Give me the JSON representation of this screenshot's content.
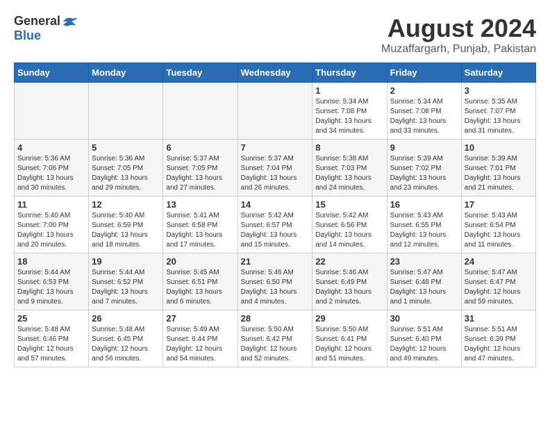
{
  "logo": {
    "general": "General",
    "blue": "Blue"
  },
  "title": "August 2024",
  "location": "Muzaffargarh, Punjab, Pakistan",
  "days_header": [
    "Sunday",
    "Monday",
    "Tuesday",
    "Wednesday",
    "Thursday",
    "Friday",
    "Saturday"
  ],
  "weeks": [
    [
      {
        "day": "",
        "info": ""
      },
      {
        "day": "",
        "info": ""
      },
      {
        "day": "",
        "info": ""
      },
      {
        "day": "",
        "info": ""
      },
      {
        "day": "1",
        "info": "Sunrise: 5:34 AM\nSunset: 7:08 PM\nDaylight: 13 hours\nand 34 minutes."
      },
      {
        "day": "2",
        "info": "Sunrise: 5:34 AM\nSunset: 7:08 PM\nDaylight: 13 hours\nand 33 minutes."
      },
      {
        "day": "3",
        "info": "Sunrise: 5:35 AM\nSunset: 7:07 PM\nDaylight: 13 hours\nand 31 minutes."
      }
    ],
    [
      {
        "day": "4",
        "info": "Sunrise: 5:36 AM\nSunset: 7:06 PM\nDaylight: 13 hours\nand 30 minutes."
      },
      {
        "day": "5",
        "info": "Sunrise: 5:36 AM\nSunset: 7:05 PM\nDaylight: 13 hours\nand 29 minutes."
      },
      {
        "day": "6",
        "info": "Sunrise: 5:37 AM\nSunset: 7:05 PM\nDaylight: 13 hours\nand 27 minutes."
      },
      {
        "day": "7",
        "info": "Sunrise: 5:37 AM\nSunset: 7:04 PM\nDaylight: 13 hours\nand 26 minutes."
      },
      {
        "day": "8",
        "info": "Sunrise: 5:38 AM\nSunset: 7:03 PM\nDaylight: 13 hours\nand 24 minutes."
      },
      {
        "day": "9",
        "info": "Sunrise: 5:39 AM\nSunset: 7:02 PM\nDaylight: 13 hours\nand 23 minutes."
      },
      {
        "day": "10",
        "info": "Sunrise: 5:39 AM\nSunset: 7:01 PM\nDaylight: 13 hours\nand 21 minutes."
      }
    ],
    [
      {
        "day": "11",
        "info": "Sunrise: 5:40 AM\nSunset: 7:00 PM\nDaylight: 13 hours\nand 20 minutes."
      },
      {
        "day": "12",
        "info": "Sunrise: 5:40 AM\nSunset: 6:59 PM\nDaylight: 13 hours\nand 18 minutes."
      },
      {
        "day": "13",
        "info": "Sunrise: 5:41 AM\nSunset: 6:58 PM\nDaylight: 13 hours\nand 17 minutes."
      },
      {
        "day": "14",
        "info": "Sunrise: 5:42 AM\nSunset: 6:57 PM\nDaylight: 13 hours\nand 15 minutes."
      },
      {
        "day": "15",
        "info": "Sunrise: 5:42 AM\nSunset: 6:56 PM\nDaylight: 13 hours\nand 14 minutes."
      },
      {
        "day": "16",
        "info": "Sunrise: 5:43 AM\nSunset: 6:55 PM\nDaylight: 13 hours\nand 12 minutes."
      },
      {
        "day": "17",
        "info": "Sunrise: 5:43 AM\nSunset: 6:54 PM\nDaylight: 13 hours\nand 11 minutes."
      }
    ],
    [
      {
        "day": "18",
        "info": "Sunrise: 5:44 AM\nSunset: 6:53 PM\nDaylight: 13 hours\nand 9 minutes."
      },
      {
        "day": "19",
        "info": "Sunrise: 5:44 AM\nSunset: 6:52 PM\nDaylight: 13 hours\nand 7 minutes."
      },
      {
        "day": "20",
        "info": "Sunrise: 5:45 AM\nSunset: 6:51 PM\nDaylight: 13 hours\nand 6 minutes."
      },
      {
        "day": "21",
        "info": "Sunrise: 5:46 AM\nSunset: 6:50 PM\nDaylight: 13 hours\nand 4 minutes."
      },
      {
        "day": "22",
        "info": "Sunrise: 5:46 AM\nSunset: 6:49 PM\nDaylight: 13 hours\nand 2 minutes."
      },
      {
        "day": "23",
        "info": "Sunrise: 5:47 AM\nSunset: 6:48 PM\nDaylight: 13 hours\nand 1 minute."
      },
      {
        "day": "24",
        "info": "Sunrise: 5:47 AM\nSunset: 6:47 PM\nDaylight: 12 hours\nand 59 minutes."
      }
    ],
    [
      {
        "day": "25",
        "info": "Sunrise: 5:48 AM\nSunset: 6:46 PM\nDaylight: 12 hours\nand 57 minutes."
      },
      {
        "day": "26",
        "info": "Sunrise: 5:48 AM\nSunset: 6:45 PM\nDaylight: 12 hours\nand 56 minutes."
      },
      {
        "day": "27",
        "info": "Sunrise: 5:49 AM\nSunset: 6:44 PM\nDaylight: 12 hours\nand 54 minutes."
      },
      {
        "day": "28",
        "info": "Sunrise: 5:50 AM\nSunset: 6:42 PM\nDaylight: 12 hours\nand 52 minutes."
      },
      {
        "day": "29",
        "info": "Sunrise: 5:50 AM\nSunset: 6:41 PM\nDaylight: 12 hours\nand 51 minutes."
      },
      {
        "day": "30",
        "info": "Sunrise: 5:51 AM\nSunset: 6:40 PM\nDaylight: 12 hours\nand 49 minutes."
      },
      {
        "day": "31",
        "info": "Sunrise: 5:51 AM\nSunset: 6:39 PM\nDaylight: 12 hours\nand 47 minutes."
      }
    ]
  ]
}
